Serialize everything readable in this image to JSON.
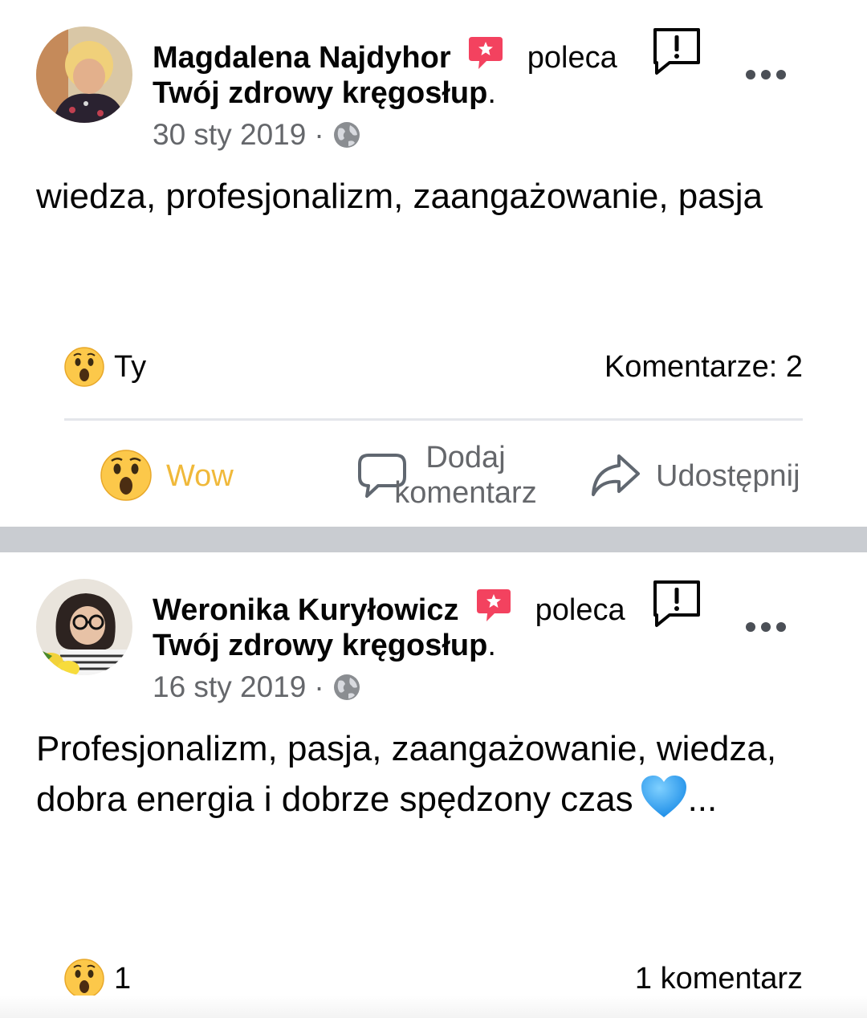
{
  "posts": [
    {
      "author": "Magdalena Najdyhor",
      "recommends": "poleca",
      "page": "Twój zdrowy kręgosłup",
      "page_suffix": ".",
      "date": "30 sty 2019",
      "separator": "·",
      "privacy_icon": "globe-icon",
      "text": "wiedza, profesjonalizm, zaangażowanie, pasja",
      "reaction_summary": "Ty",
      "comments": "Komentarze: 2",
      "actions": {
        "react_label": "Wow",
        "comment_label": "Dodaj komentarz",
        "share_label": "Udostępnij"
      }
    },
    {
      "author": "Weronika Kuryłowicz",
      "recommends": "poleca",
      "page": "Twój zdrowy kręgosłup",
      "page_suffix": ".",
      "date": "16 sty 2019",
      "separator": "·",
      "privacy_icon": "globe-icon",
      "text": "Profesjonalizm, pasja, zaangażowanie, wiedza, dobra energia i dobrze spędzony czas",
      "text_suffix": "...",
      "reaction_summary": "1",
      "comments": "1 komentarz"
    }
  ],
  "colors": {
    "wow_accent": "#f0b93a",
    "recommend_badge": "#f3425f",
    "secondary_text": "#65676b",
    "divider_band": "#c9ccd1",
    "heart": "#3aa5f5"
  },
  "icons": [
    "recommend-badge-icon",
    "report-icon",
    "more-icon",
    "globe-icon",
    "wow-emoji-icon",
    "comment-icon",
    "share-icon",
    "blue-heart-emoji"
  ]
}
